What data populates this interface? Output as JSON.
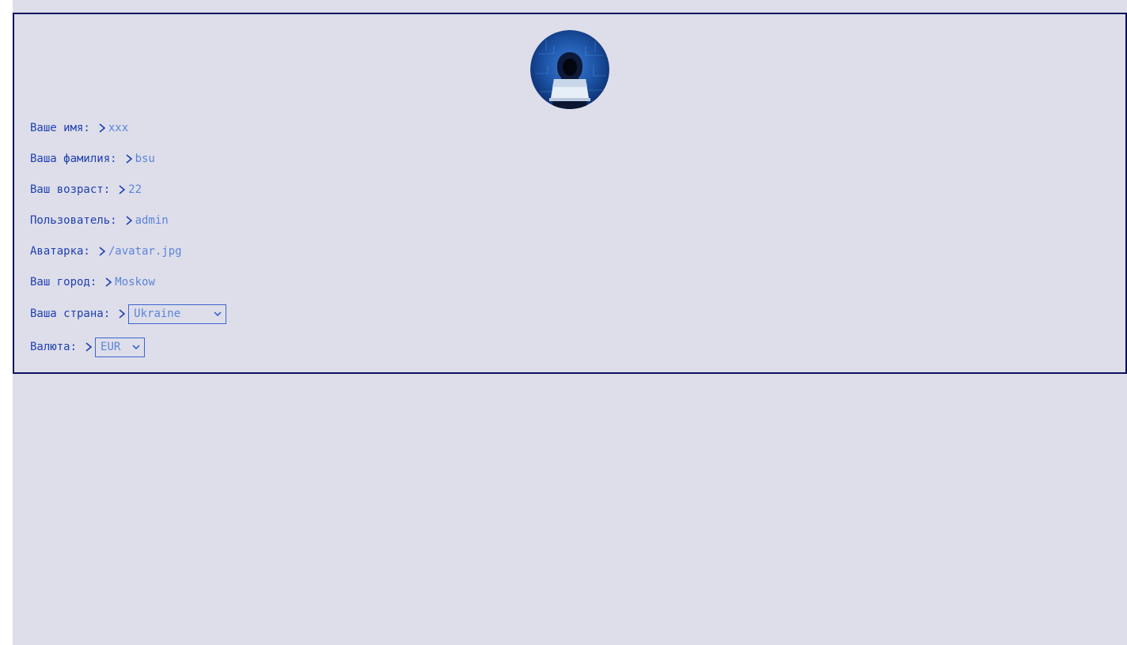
{
  "profile": {
    "avatar_alt": "hooded-hacker-avatar",
    "fields": [
      {
        "label": "Ваше имя:",
        "value": "xxx"
      },
      {
        "label": "Ваша фамилия:",
        "value": "bsu"
      },
      {
        "label": "Ваш возраст:",
        "value": "22"
      },
      {
        "label": "Пользователь:",
        "value": "admin"
      },
      {
        "label": "Аватарка:",
        "value": "/avatar.jpg"
      },
      {
        "label": "Ваш город:",
        "value": "Moskow"
      }
    ],
    "country": {
      "label": "Ваша страна:",
      "selected": "Ukraine"
    },
    "currency": {
      "label": "Валюта:",
      "selected": "EUR"
    }
  },
  "colors": {
    "page_bg": "#dedeea",
    "card_border": "#0d0d5e",
    "label": "#1d3fb0",
    "value": "#5a84d8",
    "select_border": "#3a66d0"
  },
  "icons": {
    "chevron": "chevron-right-icon",
    "select_arrow": "chevron-down-icon"
  }
}
